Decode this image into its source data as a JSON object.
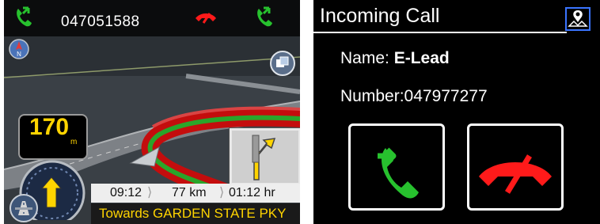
{
  "nav": {
    "phone_number": "047051588",
    "speed": "170",
    "speed_unit": "m",
    "eta": "09:12",
    "distance": "77 km",
    "duration": "01:12 hr",
    "direction": "Towards GARDEN STATE PKY",
    "compass_letter": "N",
    "icons": [
      "phone-answer-icon",
      "phone-hangup-icon",
      "phone-answer-icon",
      "compass-icon",
      "route-overview-icon",
      "turn-arrow-icon",
      "highway-icon"
    ]
  },
  "call": {
    "title": "Incoming Call",
    "name_label": "Name: ",
    "name_value": "E-Lead",
    "number_label": "Number:",
    "number_value": "047977277",
    "icons": [
      "map-icon",
      "answer-call-icon",
      "decline-call-icon"
    ]
  },
  "colors": {
    "answer": "#27c12e",
    "decline": "#ff1a1a",
    "nav_text_yellow": "#ffd400"
  }
}
